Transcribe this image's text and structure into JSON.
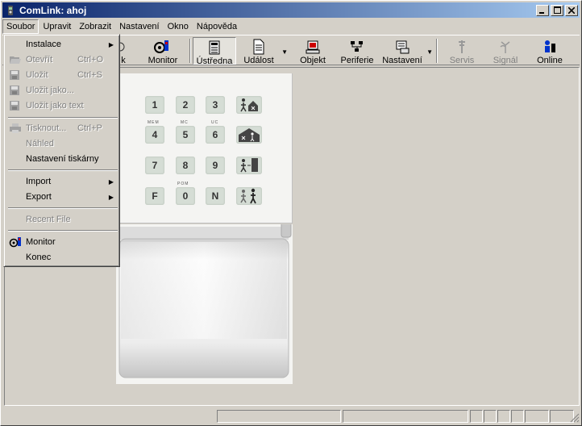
{
  "window": {
    "title": "ComLink: ahoj"
  },
  "menubar": [
    "Soubor",
    "Upravit",
    "Zobrazit",
    "Nastavení",
    "Okno",
    "Nápověda"
  ],
  "toolbar": {
    "hidden_partial": "k",
    "monitor": "Monitor",
    "ustredna": "Ústředna",
    "udalost": "Událost",
    "objekt": "Objekt",
    "periferie": "Periferie",
    "nastaveni": "Nastavení",
    "servis": "Servis",
    "signal": "Signál",
    "online": "Online"
  },
  "keypad": {
    "keys": [
      "1",
      "2",
      "3",
      "4",
      "5",
      "6",
      "7",
      "8",
      "9",
      "F",
      "0",
      "N"
    ],
    "labels": {
      "mem": "MEM",
      "mc": "MC",
      "uc": "UC",
      "pom": "POM"
    }
  },
  "file_menu": {
    "instalace": "Instalace",
    "otevrit": "Otevřít",
    "otevrit_sc": "Ctrl+O",
    "ulozit": "Uložit",
    "ulozit_sc": "Ctrl+S",
    "ulozit_jako": "Uložit jako...",
    "ulozit_text": "Uložit jako text",
    "tisknout": "Tisknout...",
    "tisknout_sc": "Ctrl+P",
    "nahled": "Náhled",
    "nastaveni_tiskarny": "Nastavení tiskárny",
    "import": "Import",
    "export": "Export",
    "recent": "Recent File",
    "monitor": "Monitor",
    "konec": "Konec"
  },
  "colors": {
    "title_start": "#0a246a",
    "title_end": "#a6caf0",
    "face": "#d4d0c8"
  }
}
